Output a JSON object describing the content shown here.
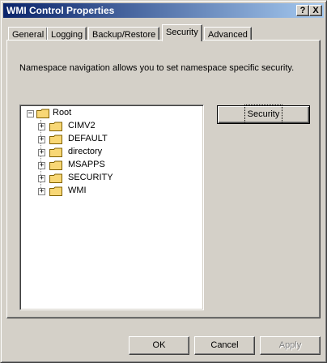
{
  "window": {
    "title": "WMI Control Properties"
  },
  "title_buttons": {
    "help": "?",
    "close": "X"
  },
  "tabs": [
    {
      "label": "General"
    },
    {
      "label": "Logging"
    },
    {
      "label": "Backup/Restore"
    },
    {
      "label": "Security",
      "selected": true
    },
    {
      "label": "Advanced"
    }
  ],
  "description": "Namespace navigation allows you to set namespace specific security.",
  "tree": {
    "root": {
      "label": "Root",
      "expand_glyph": "−"
    },
    "children": [
      {
        "label": "CIMV2",
        "expand_glyph": "+"
      },
      {
        "label": "DEFAULT",
        "expand_glyph": "+"
      },
      {
        "label": "directory",
        "expand_glyph": "+"
      },
      {
        "label": "MSAPPS",
        "expand_glyph": "+"
      },
      {
        "label": "SECURITY",
        "expand_glyph": "+"
      },
      {
        "label": "WMI",
        "expand_glyph": "+"
      }
    ]
  },
  "security_button": "Security",
  "footer": {
    "ok": "OK",
    "cancel": "Cancel",
    "apply": "Apply"
  },
  "colors": {
    "title_start": "#0a246a",
    "title_end": "#a6caf0",
    "face": "#d4d0c8",
    "folder": "#f8d775"
  }
}
